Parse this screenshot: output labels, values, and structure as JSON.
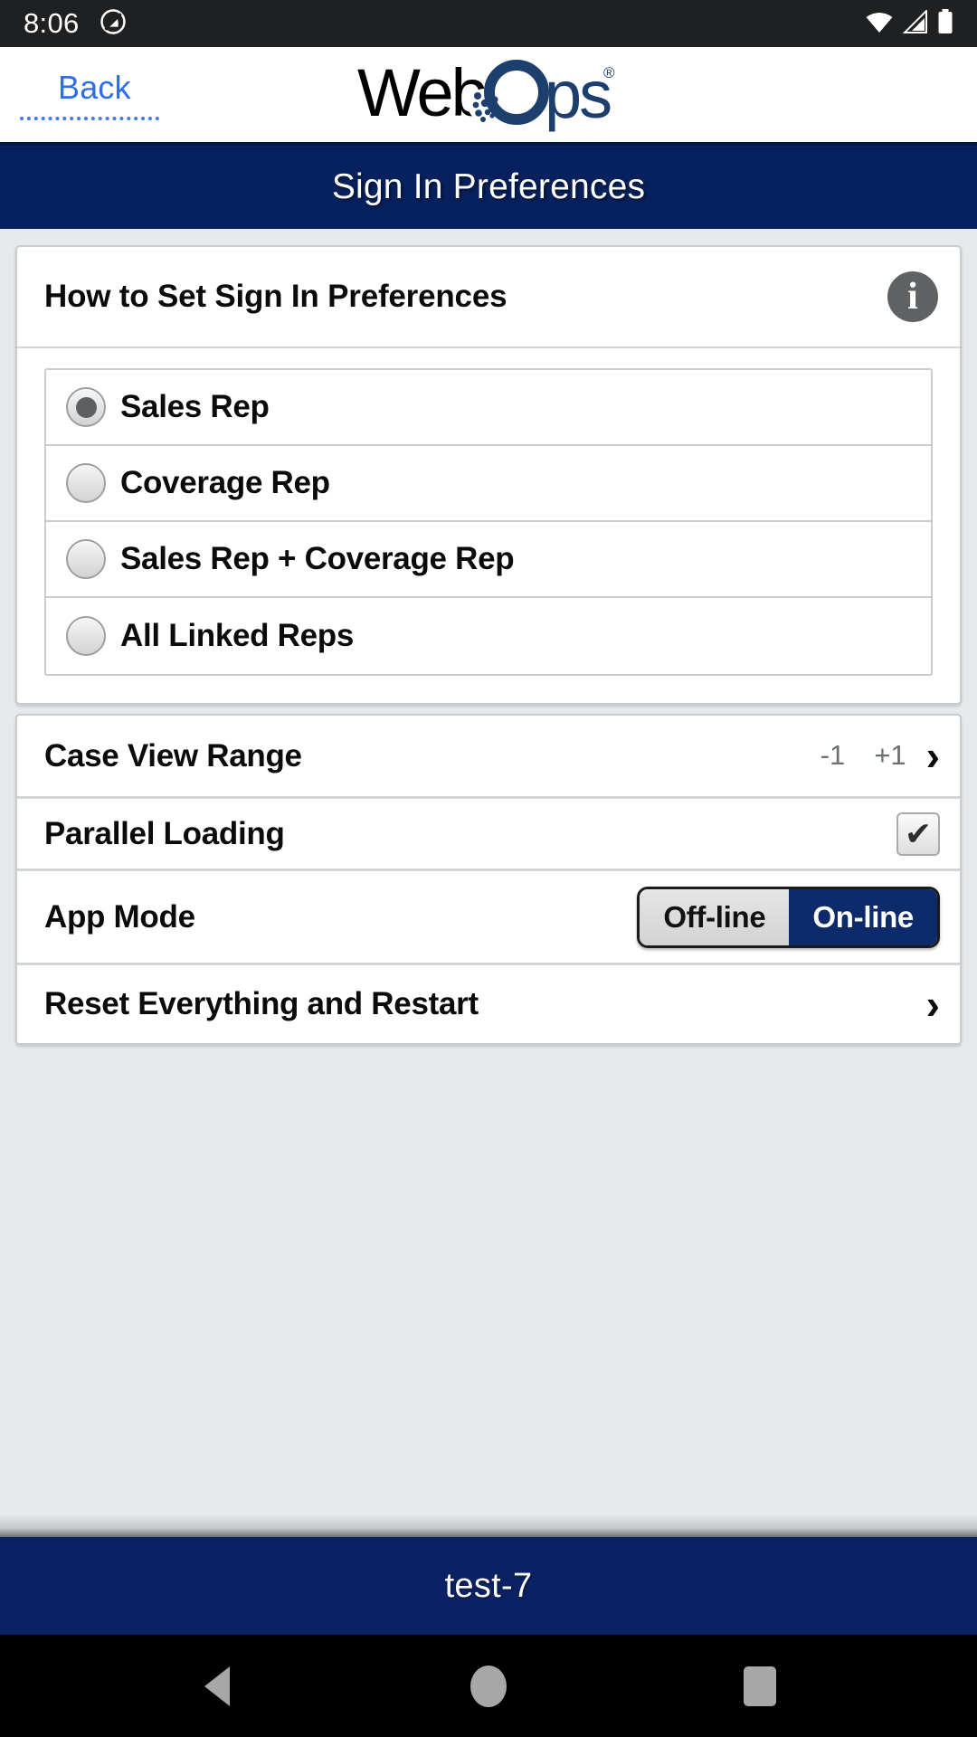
{
  "status_bar": {
    "time": "8:06",
    "icons": [
      "do-not-disturb-icon",
      "wifi-icon",
      "cellular-signal-icon",
      "battery-icon"
    ]
  },
  "brand_header": {
    "back_label": "Back",
    "logo_text_primary": "Web",
    "logo_text_secondary": "Ops",
    "logo_registered_mark": "®"
  },
  "page": {
    "title": "Sign In Preferences",
    "title_bar_color": "#06215e"
  },
  "panel": {
    "heading": "How to Set Sign In Preferences",
    "info_glyph": "i"
  },
  "sign_in_options": {
    "selected": "Sales Rep",
    "items": [
      {
        "label": "Sales Rep",
        "checked": true
      },
      {
        "label": "Coverage Rep",
        "checked": false
      },
      {
        "label": "Sales Rep + Coverage Rep",
        "checked": false
      },
      {
        "label": "All Linked Reps",
        "checked": false
      }
    ]
  },
  "settings": {
    "case_view_range": {
      "label": "Case View Range",
      "min_value": "-1",
      "max_value": "+1",
      "chevron": "›"
    },
    "parallel_loading": {
      "label": "Parallel Loading",
      "checked": true,
      "check_glyph": "✔"
    },
    "app_mode": {
      "label": "App Mode",
      "options": [
        "Off-line",
        "On-line"
      ],
      "selected": "On-line",
      "active_color": "#0d2a6b"
    },
    "reset": {
      "label": "Reset Everything and Restart",
      "chevron": "›"
    }
  },
  "bottom_bar": {
    "text": "test-7",
    "color": "#0a2263"
  },
  "nav_bar": {
    "buttons": [
      "back-triangle-icon",
      "home-circle-icon",
      "recents-square-icon"
    ]
  }
}
